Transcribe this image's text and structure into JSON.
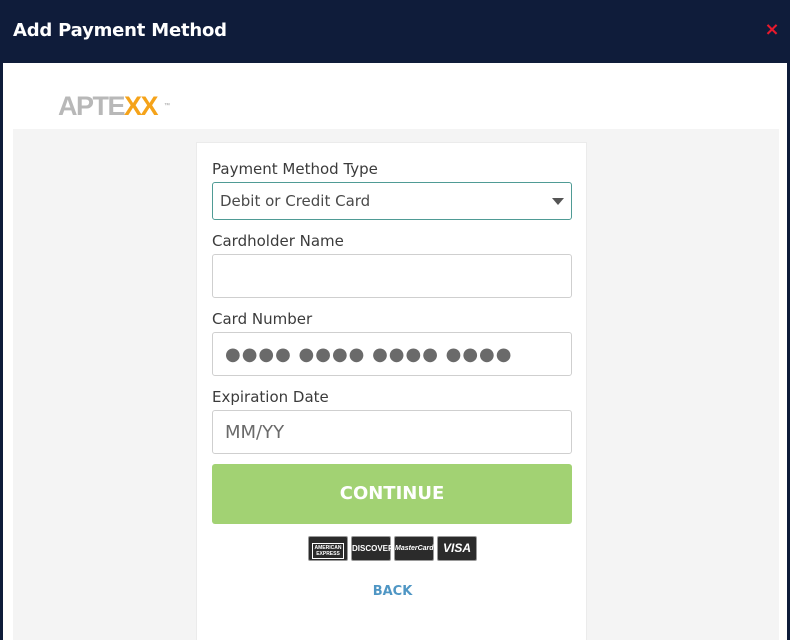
{
  "modal": {
    "title": "Add Payment Method",
    "close_symbol": "×"
  },
  "logo": {
    "part1": "APTE",
    "part2": "XX",
    "trademark": "™"
  },
  "form": {
    "payment_type": {
      "label": "Payment Method Type",
      "selected": "Debit or Credit Card"
    },
    "cardholder": {
      "label": "Cardholder Name",
      "value": "",
      "placeholder": ""
    },
    "card_number": {
      "label": "Card Number",
      "placeholder": "●●●● ●●●● ●●●● ●●●●"
    },
    "expiration": {
      "label": "Expiration Date",
      "placeholder": "MM/YY"
    },
    "continue_label": "CONTINUE",
    "back_label": "BACK"
  },
  "accepted_cards": {
    "amex": "AMERICAN EXPRESS",
    "discover": "DISCOVER",
    "mastercard": "MasterCard",
    "visa": "VISA"
  },
  "colors": {
    "header_bg": "#0f1c3a",
    "close": "#e8192c",
    "select_border": "#4f9b95",
    "continue_bg": "#a2d273",
    "back_link": "#4f96c4",
    "logo_accent": "#f5a31a"
  },
  "icons": {
    "close": "close-icon",
    "dropdown": "caret-down-icon"
  }
}
